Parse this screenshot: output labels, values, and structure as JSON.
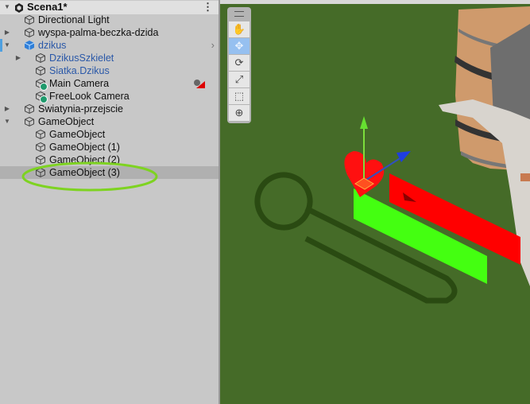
{
  "hierarchy": {
    "scene_name": "Scena1*",
    "items": [
      {
        "label": "Directional Light",
        "depth": 1,
        "expandable": false,
        "style": "normal"
      },
      {
        "label": "wyspa-palma-beczka-dzida",
        "depth": 1,
        "expandable": true,
        "expanded": false,
        "style": "normal"
      },
      {
        "label": "dzikus",
        "depth": 1,
        "expandable": true,
        "expanded": true,
        "style": "prefab"
      },
      {
        "label": "DzikusSzkielet",
        "depth": 2,
        "expandable": true,
        "expanded": false,
        "style": "prefab"
      },
      {
        "label": "Siatka.Dzikus",
        "depth": 2,
        "expandable": false,
        "style": "prefab"
      },
      {
        "label": "Main Camera",
        "depth": 2,
        "expandable": false,
        "style": "normal",
        "icon": "camera"
      },
      {
        "label": "FreeLook Camera",
        "depth": 2,
        "expandable": false,
        "style": "normal",
        "icon": "camera"
      },
      {
        "label": "Swiatynia-przejscie",
        "depth": 1,
        "expandable": true,
        "expanded": false,
        "style": "normal"
      },
      {
        "label": "GameObject",
        "depth": 1,
        "expandable": true,
        "expanded": true,
        "style": "normal"
      },
      {
        "label": "GameObject",
        "depth": 2,
        "expandable": false,
        "style": "normal"
      },
      {
        "label": "GameObject (1)",
        "depth": 2,
        "expandable": false,
        "style": "normal"
      },
      {
        "label": "GameObject (2)",
        "depth": 2,
        "expandable": false,
        "style": "normal"
      },
      {
        "label": "GameObject (3)",
        "depth": 2,
        "expandable": false,
        "style": "normal",
        "selected": true,
        "highlighted": true
      }
    ]
  },
  "scene_view": {
    "tools": [
      {
        "name": "hand",
        "glyph": "✋",
        "active": false
      },
      {
        "name": "move",
        "glyph": "✥",
        "active": true
      },
      {
        "name": "rotate",
        "glyph": "⟳",
        "active": false
      },
      {
        "name": "scale",
        "glyph": "⤢",
        "active": false
      },
      {
        "name": "rect",
        "glyph": "⬚",
        "active": false
      },
      {
        "name": "transform",
        "glyph": "⊕",
        "active": false
      }
    ]
  },
  "colors": {
    "panel_bg": "#c8c8c8",
    "selected_row": "#b0b0b0",
    "prefab_text": "#2a58a8",
    "ground": "#456b28",
    "annotation": "#7ed321",
    "red_plane": "#ff0000",
    "green_plane": "#44ff11"
  }
}
